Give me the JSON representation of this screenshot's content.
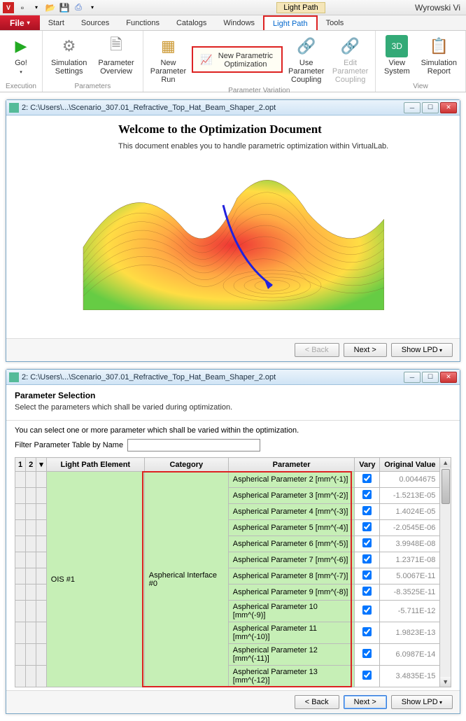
{
  "app_title": "Wyrowski Vi",
  "context_tab": "Light Path",
  "menu": {
    "file": "File",
    "tabs": [
      "Start",
      "Sources",
      "Functions",
      "Catalogs",
      "Windows",
      "Light Path",
      "Tools"
    ],
    "active": "Light Path"
  },
  "ribbon": {
    "go": "Go!",
    "sim_settings": "Simulation\nSettings",
    "param_overview": "Parameter\nOverview",
    "new_param_run": "New\nParameter Run",
    "new_param_opt": "New Parametric Optimization",
    "use_coupling": "Use Parameter\nCoupling",
    "edit_coupling": "Edit Parameter\nCoupling",
    "view_system": "View\nSystem",
    "sim_report": "Simulation\nReport",
    "groups": {
      "execution": "Execution",
      "parameters": "Parameters",
      "variation": "Parameter Variation",
      "view": "View"
    }
  },
  "window1": {
    "title": "2: C:\\Users\\...\\Scenario_307.01_Refractive_Top_Hat_Beam_Shaper_2.opt",
    "heading": "Welcome to the Optimization Document",
    "desc": "This document enables you to handle parametric optimization within VirtualLab.",
    "back": "< Back",
    "next": "Next >",
    "show": "Show  LPD"
  },
  "window2": {
    "title": "2: C:\\Users\\...\\Scenario_307.01_Refractive_Top_Hat_Beam_Shaper_2.opt",
    "heading": "Parameter Selection",
    "sub": "Select the parameters which shall be varied during optimization.",
    "hint": "You can select one or more parameter which shall be varied within the optimization.",
    "filter_label": "Filter Parameter Table by Name",
    "filter_value": "",
    "cols": {
      "c1": "1",
      "c2": "2",
      "lpe": "Light Path Element",
      "cat": "Category",
      "param": "Parameter",
      "vary": "Vary",
      "orig": "Original Value"
    },
    "lpe": "OIS #1",
    "cat": "Aspherical Interface #0",
    "rows": [
      {
        "param": "Aspherical Parameter 2 [mm^(-1)]",
        "vary": true,
        "orig": "0.0044675"
      },
      {
        "param": "Aspherical Parameter 3 [mm^(-2)]",
        "vary": true,
        "orig": "-1.5213E-05"
      },
      {
        "param": "Aspherical Parameter 4 [mm^(-3)]",
        "vary": true,
        "orig": "1.4024E-05"
      },
      {
        "param": "Aspherical Parameter 5 [mm^(-4)]",
        "vary": true,
        "orig": "-2.0545E-06"
      },
      {
        "param": "Aspherical Parameter 6 [mm^(-5)]",
        "vary": true,
        "orig": "3.9948E-08"
      },
      {
        "param": "Aspherical Parameter 7 [mm^(-6)]",
        "vary": true,
        "orig": "1.2371E-08"
      },
      {
        "param": "Aspherical Parameter 8 [mm^(-7)]",
        "vary": true,
        "orig": "5.0067E-11"
      },
      {
        "param": "Aspherical Parameter 9 [mm^(-8)]",
        "vary": true,
        "orig": "-8.3525E-11"
      },
      {
        "param": "Aspherical Parameter 10 [mm^(-9)]",
        "vary": true,
        "orig": "-5.711E-12"
      },
      {
        "param": "Aspherical Parameter 11 [mm^(-10)]",
        "vary": true,
        "orig": "1.9823E-13"
      },
      {
        "param": "Aspherical Parameter 12 [mm^(-11)]",
        "vary": true,
        "orig": "6.0987E-14"
      },
      {
        "param": "Aspherical Parameter 13 [mm^(-12)]",
        "vary": true,
        "orig": "3.4835E-15"
      }
    ],
    "back": "< Back",
    "next": "Next >",
    "show": "Show  LPD"
  }
}
